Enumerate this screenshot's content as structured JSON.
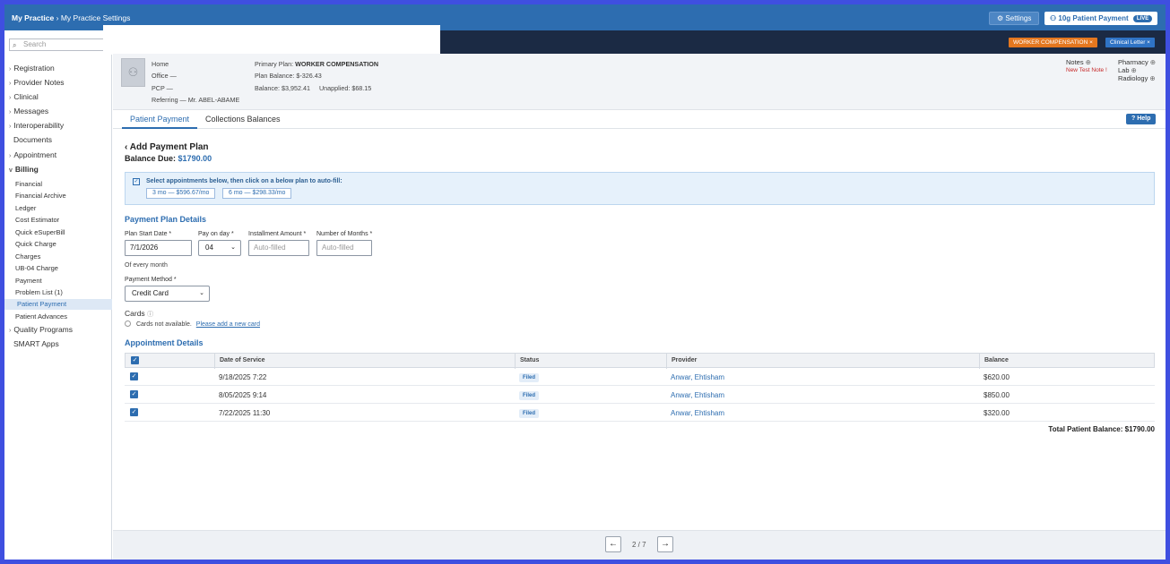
{
  "topbar": {
    "breadcrumb_home": "My Practice",
    "breadcrumb_sep": "›",
    "breadcrumb_current": "My Practice Settings",
    "settings_label": "Settings",
    "patient_payment_label": "10g Patient Payment",
    "live_badge": "LIVE"
  },
  "alerts": {
    "worker_comp": "WORKER COMPENSATION ×",
    "clinical_letter": "Clinical Letter ×"
  },
  "sidebar": {
    "search_placeholder": "Search",
    "items": [
      {
        "label": "Registration",
        "caret": "›"
      },
      {
        "label": "Provider Notes",
        "caret": "›"
      },
      {
        "label": "Clinical",
        "caret": "›"
      },
      {
        "label": "Messages",
        "caret": "›"
      },
      {
        "label": "Interoperability",
        "caret": "›"
      },
      {
        "label": "Documents",
        "caret": ""
      },
      {
        "label": "Appointment",
        "caret": "›"
      },
      {
        "label": "Billing",
        "caret": "v"
      }
    ],
    "billing_sub": [
      "Financial",
      "Financial Archive",
      "Ledger",
      "Cost Estimator",
      "Quick eSuperBill",
      "Quick Charge",
      "Charges",
      "UB-04 Charge",
      "Payment",
      "Problem List (1)",
      "Patient Payment",
      "Patient Advances"
    ],
    "after": [
      {
        "label": "Quality Programs",
        "caret": "›"
      },
      {
        "label": "SMART Apps",
        "caret": ""
      }
    ]
  },
  "patient": {
    "home": "Home",
    "office": "Office —",
    "pcp": "PCP —",
    "referring": "Referring — Mr. ABEL-ABAME",
    "primary_plan_label": "Primary Plan:",
    "primary_plan": "WORKER COMPENSATION",
    "plan_balance": "Plan Balance: $-326.43",
    "balance": "Balance: $3,952.41",
    "unapplied": "Unapplied: $68.15",
    "notes": "Notes",
    "new_note": "New Test Note !",
    "pharmacy": "Pharmacy",
    "lab": "Lab",
    "radiology": "Radiology",
    "plus": "⊕"
  },
  "tabs": {
    "active": "Patient Payment",
    "other": "Collections Balances",
    "help": "? Help"
  },
  "plan": {
    "title": "‹ Add Payment Plan",
    "balance_label": "Balance Due:",
    "balance_value": "$1790.00",
    "hint": "Select appointments below, then click on a below plan to auto-fill:",
    "option_3": "3 mo — $596.67/mo",
    "option_6": "6 mo — $298.33/mo",
    "details_title": "Payment Plan Details",
    "start_label": "Plan Start Date *",
    "start_value": "7/1/2026",
    "day_label": "Pay on day *",
    "day_value": "04",
    "installment_label": "Installment Amount *",
    "installment_placeholder": "Auto-filled",
    "months_label": "Number of Months *",
    "months_placeholder": "Auto-filled",
    "every_month": "Of every month",
    "method_label": "Payment Method *",
    "method_value": "Credit Card",
    "cards_label": "Cards",
    "cards_na": "Cards not available.",
    "add_card": "Please add a new card"
  },
  "appointments": {
    "title": "Appointment Details",
    "columns": [
      "Date of Service",
      "Status",
      "Provider",
      "Balance"
    ],
    "rows": [
      {
        "date": "9/18/2025 7:22",
        "status": "Filed",
        "provider": "Anwar, Ehtisham",
        "balance": "$620.00"
      },
      {
        "date": "8/05/2025 9:14",
        "status": "Filed",
        "provider": "Anwar, Ehtisham",
        "balance": "$850.00"
      },
      {
        "date": "7/22/2025 11:30",
        "status": "Filed",
        "provider": "Anwar, Ehtisham",
        "balance": "$320.00"
      }
    ],
    "total_label": "Total Patient Balance:",
    "total_value": "$1790.00"
  },
  "pager": {
    "prev": "←",
    "next": "→",
    "page": "2 / 7"
  },
  "colors": {
    "primary": "#2d6db0",
    "dark_bar": "#1b2a44",
    "orange": "#e4771f"
  }
}
